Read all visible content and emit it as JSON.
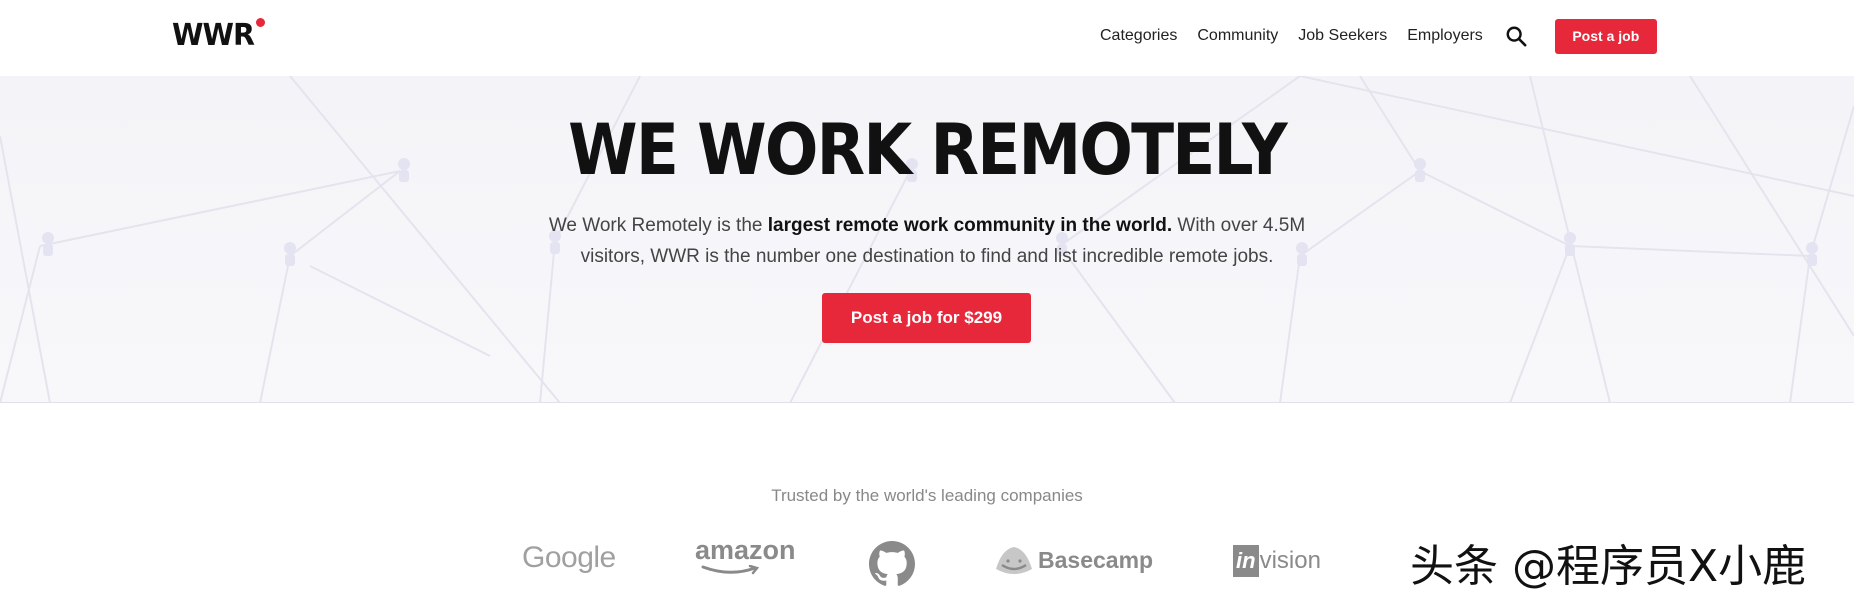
{
  "header": {
    "logo_text": "WWR",
    "nav": [
      "Categories",
      "Community",
      "Job Seekers",
      "Employers"
    ],
    "post_job_label": "Post a job"
  },
  "hero": {
    "title": "WE WORK REMOTELY",
    "desc_prefix": "We Work Remotely is the ",
    "desc_bold": "largest remote work community in the world.",
    "desc_suffix": " With over 4.5M visitors, WWR is the number one destination to find and list incredible remote jobs.",
    "cta_label": "Post a job for $299"
  },
  "trusted": {
    "caption": "Trusted by the world's leading companies",
    "companies": [
      "Google",
      "amazon",
      "GitHub",
      "Basecamp",
      "invision"
    ]
  },
  "logo_text": {
    "google": "Google",
    "amazon": "amazon",
    "basecamp": "Basecamp",
    "invision_box": "in",
    "invision_rest": "vision"
  },
  "watermark": "头条 @程序员X小鹿",
  "colors": {
    "accent": "#e6283a",
    "hero_bg": "#f4f4f8",
    "logo_gray": "#8a8a8a"
  }
}
